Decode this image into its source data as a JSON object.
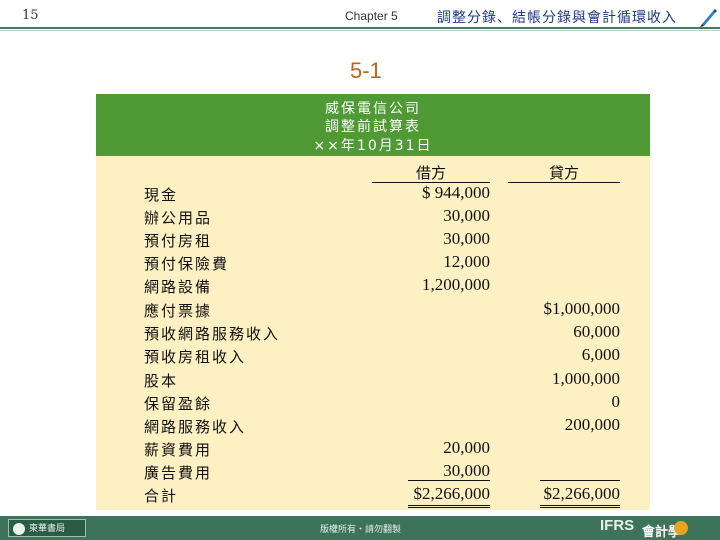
{
  "header": {
    "page_number": "15",
    "chapter": "Chapter 5",
    "title": "調整分錄、結帳分錄與會計循環收入"
  },
  "section_label": "5-1",
  "statement": {
    "company": "威保電信公司",
    "name": "調整前試算表",
    "date": "××年10月31日",
    "debit_header": "借方",
    "credit_header": "貸方",
    "rows": [
      {
        "account": "現金",
        "debit": "$ 944,000",
        "credit": ""
      },
      {
        "account": "辦公用品",
        "debit": "30,000",
        "credit": ""
      },
      {
        "account": "預付房租",
        "debit": "30,000",
        "credit": ""
      },
      {
        "account": "預付保險費",
        "debit": "12,000",
        "credit": ""
      },
      {
        "account": "網路設備",
        "debit": "1,200,000",
        "credit": ""
      },
      {
        "account": "應付票據",
        "debit": "",
        "credit": "$1,000,000"
      },
      {
        "account": "預收網路服務收入",
        "debit": "",
        "credit": "60,000"
      },
      {
        "account": "預收房租收入",
        "debit": "",
        "credit": "6,000"
      },
      {
        "account": "股本",
        "debit": "",
        "credit": "1,000,000"
      },
      {
        "account": "保留盈餘",
        "debit": "",
        "credit": "0"
      },
      {
        "account": "網路服務收入",
        "debit": "",
        "credit": "200,000"
      },
      {
        "account": "薪資費用",
        "debit": "20,000",
        "credit": ""
      },
      {
        "account": "廣告費用",
        "debit": "30,000",
        "credit": ""
      },
      {
        "account": "合計",
        "debit": "$2,266,000",
        "credit": "$2,266,000"
      }
    ]
  },
  "footer": {
    "publisher": "東華書局",
    "copyright": "版權所有・請勿翻製",
    "brand_ifrs": "IFRS",
    "brand_text": "會計學"
  },
  "colors": {
    "header_green": "#4f9a35",
    "panel_yellow": "#fdf0c2",
    "footer_green": "#3d7358",
    "section_orange": "#c0641f",
    "title_blue": "#1f3a8a"
  }
}
